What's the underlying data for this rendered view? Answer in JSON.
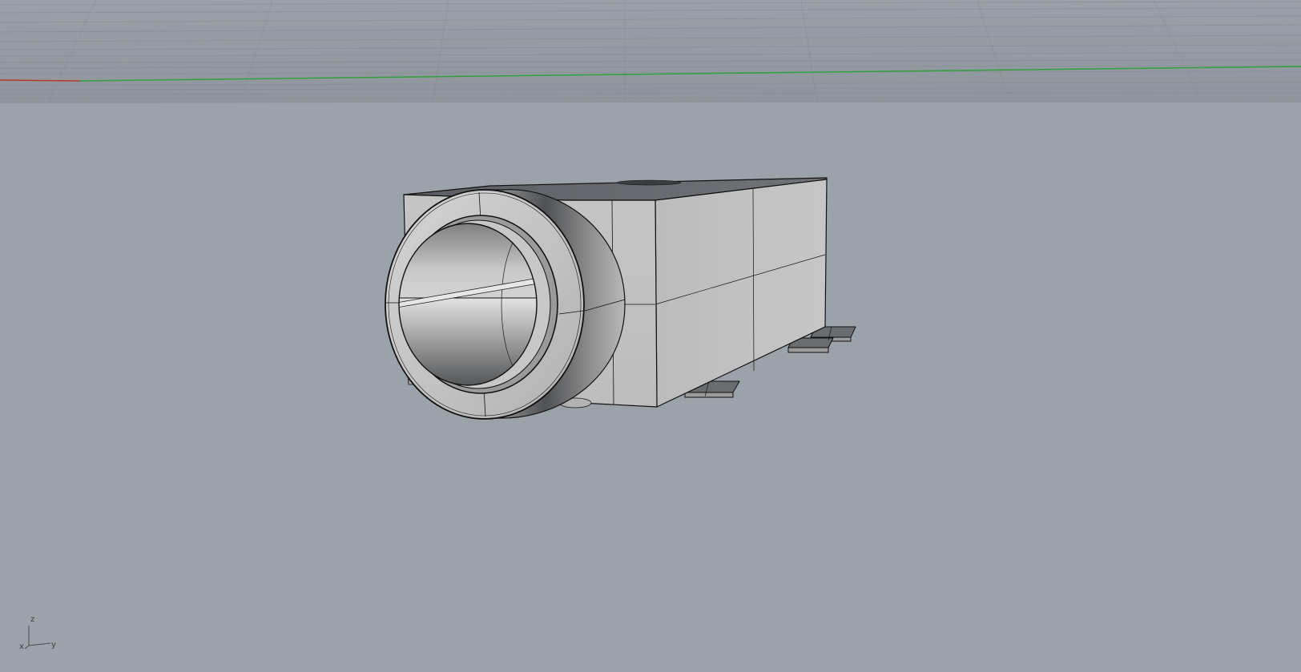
{
  "viewport": {
    "view": "perspective",
    "display_mode": "shaded",
    "background": "#9ba2a9",
    "grid_color": "#8a9097",
    "axis_colors": {
      "x": "#c0392b",
      "y": "#2e9b3a"
    }
  },
  "model": {
    "description_icon": "jack-connector-model",
    "surface_color": "#c8c8c8",
    "edge_color": "#101010"
  },
  "axis_widget": {
    "x_label": "x",
    "y_label": "y",
    "z_label": "z"
  }
}
